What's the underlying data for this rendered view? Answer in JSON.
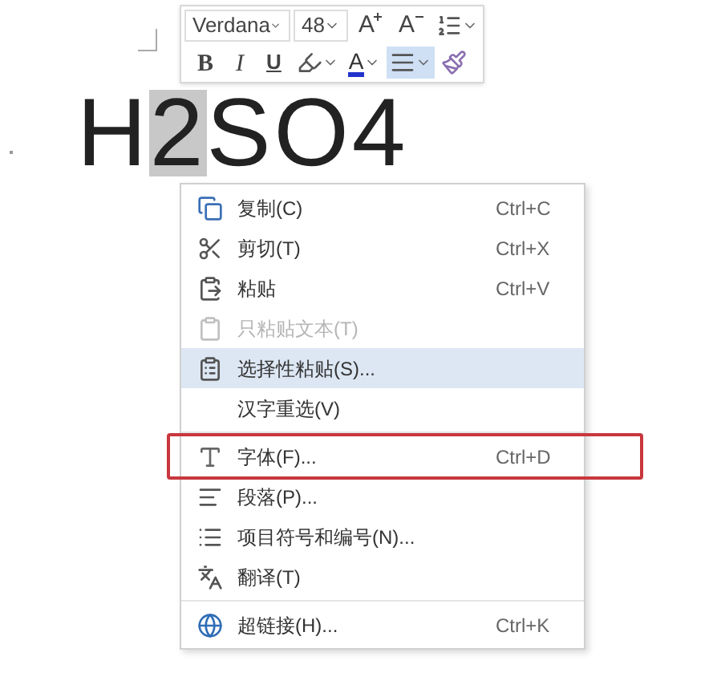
{
  "document": {
    "text": [
      {
        "text": "H",
        "selected": false
      },
      {
        "text": "2",
        "selected": true
      },
      {
        "text": "SO4",
        "selected": false
      }
    ]
  },
  "mini_toolbar": {
    "font": {
      "value": "Verdana"
    },
    "size": {
      "value": "48"
    },
    "row_1": [
      {
        "kind": "grow",
        "label": "A"
      },
      {
        "kind": "shrink",
        "label": "A"
      },
      {
        "kind": "spacing"
      }
    ],
    "row_2": [
      {
        "kind": "bold",
        "label": "B",
        "selected": false
      },
      {
        "kind": "italic",
        "label": "I",
        "selected": false
      },
      {
        "kind": "underline",
        "label": "U",
        "selected": false
      },
      {
        "kind": "highlight",
        "selected": false
      },
      {
        "kind": "color",
        "label": "A",
        "selected": false
      },
      {
        "kind": "align",
        "selected": true
      },
      {
        "kind": "painter",
        "selected": false
      }
    ]
  },
  "context_menu": {
    "groups": [
      [
        {
          "kind": "copy",
          "label": "复制(C)",
          "shortcut": "Ctrl+C",
          "disabled": false,
          "selected": false,
          "highlighted": false
        },
        {
          "kind": "cut",
          "label": "剪切(T)",
          "shortcut": "Ctrl+X",
          "disabled": false,
          "selected": false,
          "highlighted": false
        },
        {
          "kind": "paste",
          "label": "粘贴",
          "shortcut": "Ctrl+V",
          "disabled": false,
          "selected": false,
          "highlighted": false
        },
        {
          "kind": "paste-text",
          "label": "只粘贴文本(T)",
          "disabled": true,
          "selected": false,
          "highlighted": false
        },
        {
          "kind": "paste-special",
          "label": "选择性粘贴(S)...",
          "disabled": false,
          "selected": true,
          "highlighted": false
        },
        {
          "kind": "none",
          "label": "汉字重选(V)",
          "disabled": false,
          "selected": false,
          "highlighted": false
        }
      ],
      [
        {
          "kind": "font",
          "label": "字体(F)...",
          "shortcut": "Ctrl+D",
          "disabled": false,
          "selected": false,
          "highlighted": true
        },
        {
          "kind": "paragraph",
          "label": "段落(P)...",
          "disabled": false,
          "selected": false,
          "highlighted": false
        },
        {
          "kind": "bullets",
          "label": "项目符号和编号(N)...",
          "disabled": false,
          "selected": false,
          "highlighted": false
        },
        {
          "kind": "translate",
          "label": "翻译(T)",
          "disabled": false,
          "selected": false,
          "highlighted": false
        }
      ],
      [
        {
          "kind": "link",
          "label": "超链接(H)...",
          "shortcut": "Ctrl+K",
          "disabled": false,
          "selected": false,
          "highlighted": false
        }
      ]
    ]
  }
}
